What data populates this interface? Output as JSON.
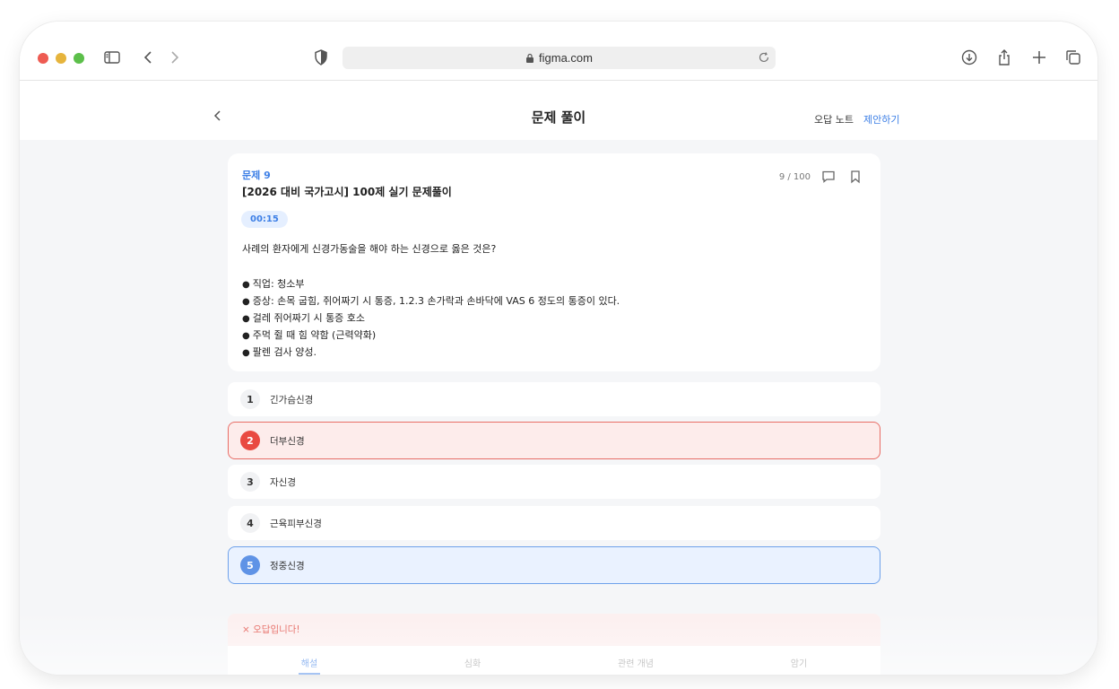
{
  "browser": {
    "url": "figma.com",
    "icons": [
      "sidebar-icon",
      "back-icon",
      "forward-icon",
      "shield-icon",
      "lock-icon",
      "reload-icon",
      "download-icon",
      "share-icon",
      "new-tab-icon",
      "tabs-icon"
    ]
  },
  "header": {
    "title": "문제 풀이",
    "wrong_note": "오답 노트",
    "suggest": "제안하기"
  },
  "question": {
    "number_label": "문제 9",
    "title": "[2026 대비 국가고시] 100제 실기 문제풀이",
    "progress": "9 / 100",
    "timer": "00:15",
    "text": "사례의 환자에게 신경가동술을 해야 하는 신경으로 옳은 것은?",
    "info": [
      "직업: 청소부",
      "증상: 손목 굽힘, 쥐어짜기 시 통증, 1.2.3 손가락과 손바닥에 VAS 6 정도의 통증이 있다.",
      "걸레 쥐어짜기 시 통증 호소",
      "주먹 쥘 때 힘 약함 (근력약화)",
      "팔렌 검사 양성."
    ]
  },
  "options": [
    {
      "num": "1",
      "label": "긴가슴신경",
      "state": "default"
    },
    {
      "num": "2",
      "label": "더부신경",
      "state": "wrong"
    },
    {
      "num": "3",
      "label": "자신경",
      "state": "default"
    },
    {
      "num": "4",
      "label": "근육피부신경",
      "state": "default"
    },
    {
      "num": "5",
      "label": "정중신경",
      "state": "correct"
    }
  ],
  "result": {
    "text": "× 오답입니다!"
  },
  "tabs": [
    "해설",
    "심화",
    "관련 개념",
    "암기"
  ],
  "colors": {
    "accent": "#3d7fe6",
    "wrong": "#e94a41",
    "correct": "#5f93e6"
  }
}
